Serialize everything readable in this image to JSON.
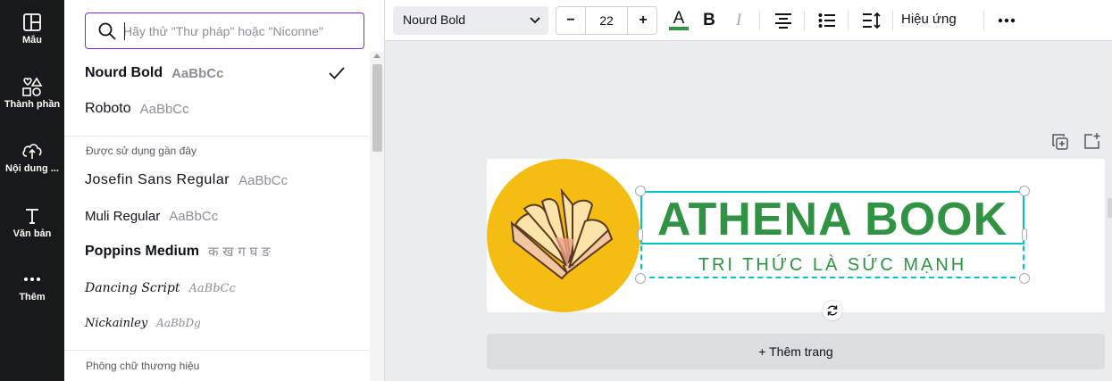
{
  "sidebar": {
    "items": [
      {
        "label": "Mẫu",
        "icon": "layout-icon"
      },
      {
        "label": "Thành phần",
        "icon": "shapes-icon"
      },
      {
        "label": "Nội dung ...",
        "icon": "cloud-upload-icon"
      },
      {
        "label": "Văn bản",
        "icon": "text-icon"
      },
      {
        "label": "Thêm",
        "icon": "more-icon"
      }
    ]
  },
  "font_panel": {
    "search": {
      "placeholder": "Hãy thử \"Thư pháp\" hoặc \"Niconne\"",
      "value": ""
    },
    "current_fonts": [
      {
        "name": "Nourd Bold",
        "sample": "AaBbCc",
        "selected": true
      },
      {
        "name": "Roboto",
        "sample": "AaBbCc",
        "selected": false
      }
    ],
    "recent_title": "Được sử dụng gần đây",
    "recent_fonts": [
      {
        "name": "Josefin Sans Regular",
        "sample": "AaBbCc"
      },
      {
        "name": "Muli Regular",
        "sample": "AaBbCc"
      },
      {
        "name": "Poppins Medium",
        "sample": "क ख ग घ ङ"
      },
      {
        "name": "Dancing Script",
        "sample": "AaBbCc"
      },
      {
        "name": "Nickainley",
        "sample": "AaBbDg"
      }
    ],
    "brand_title": "Phông chữ thương hiệu"
  },
  "toolbar": {
    "font_name": "Nourd Bold",
    "font_size": "22",
    "decrease_label": "−",
    "increase_label": "+",
    "text_color_letter": "A",
    "text_color": "#2f9343",
    "bold_label": "B",
    "italic_label": "I",
    "effects_label": "Hiệu ứng"
  },
  "design": {
    "title": "ATHENA BOOK",
    "subtitle": "TRI THỨC LÀ SỨC MẠNH",
    "title_color": "#2f9343",
    "circle_color": "#f5bd12",
    "selection_color": "#00c4cc"
  },
  "add_page_label": "+ Thêm trang"
}
